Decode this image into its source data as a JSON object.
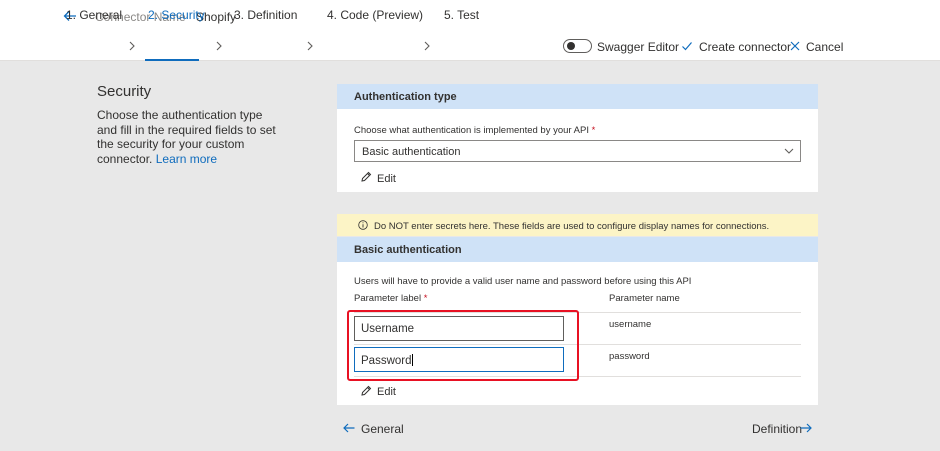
{
  "header": {
    "connector_label": "Connector Name",
    "connector_name": "Shopify"
  },
  "steps": [
    {
      "label": "1. General",
      "active": false
    },
    {
      "label": "2. Security",
      "active": true
    },
    {
      "label": "3. Definition",
      "active": false
    },
    {
      "label": "4. Code (Preview)",
      "active": false
    },
    {
      "label": "5. Test",
      "active": false
    }
  ],
  "toolbar": {
    "swagger_label": "Swagger Editor",
    "swagger_enabled": false,
    "create_label": "Create connector",
    "cancel_label": "Cancel"
  },
  "intro": {
    "title": "Security",
    "description": "Choose the authentication type and fill in the required fields to set the security for your custom connector.",
    "learn_more": "Learn more"
  },
  "auth_card": {
    "header": "Authentication type",
    "question": "Choose what authentication is implemented by your API",
    "required_mark": "*",
    "selected": "Basic authentication",
    "edit_label": "Edit"
  },
  "warning": {
    "text": "Do NOT enter secrets here. These fields are used to configure display names for connections."
  },
  "basic_card": {
    "header": "Basic authentication",
    "info": "Users will have to provide a valid user name and password before using this API",
    "col_label": "Parameter label",
    "required_mark": "*",
    "col_name": "Parameter name",
    "rows": [
      {
        "label": "Username",
        "name": "username"
      },
      {
        "label": "Password",
        "name": "password"
      }
    ],
    "edit_label": "Edit"
  },
  "footer": {
    "prev_label": "General",
    "next_label": "Definition"
  },
  "colors": {
    "accent": "#0f6cbd",
    "card_header": "#cfe2f7",
    "warning_bg": "#fcf4c6",
    "highlight": "#e81123"
  }
}
